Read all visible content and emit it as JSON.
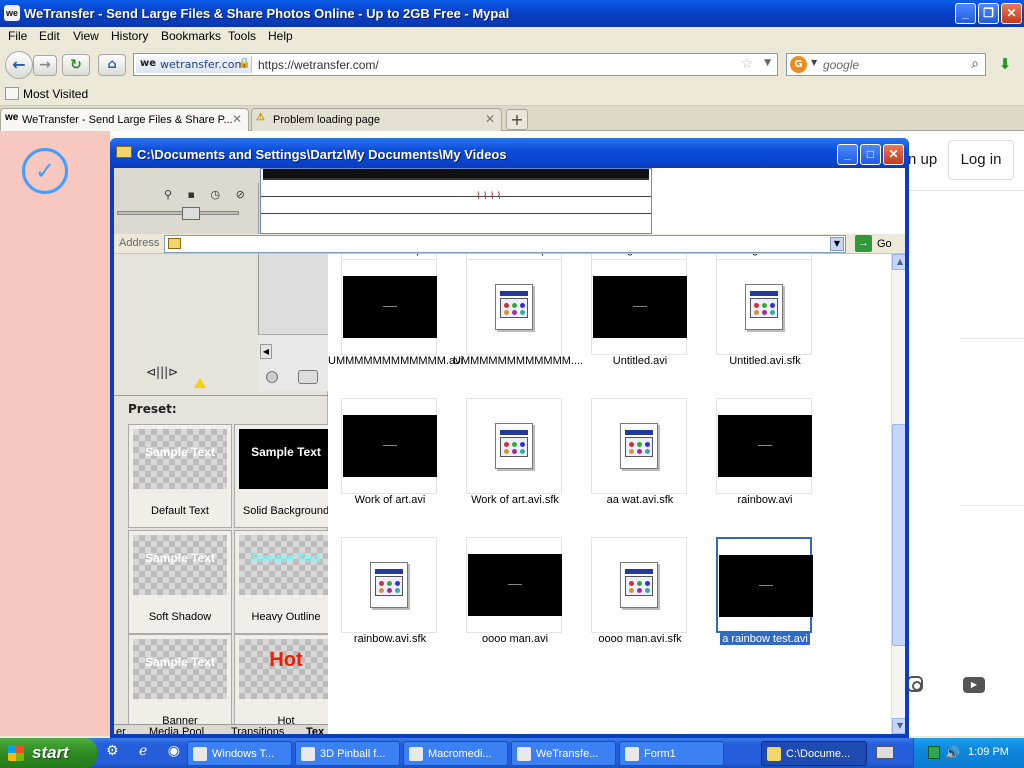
{
  "browser": {
    "title": "WeTransfer - Send Large Files & Share Photos Online - Up to 2GB Free - Mypal",
    "menu": [
      "File",
      "Edit",
      "View",
      "History",
      "Bookmarks",
      "Tools",
      "Help"
    ],
    "site_identity": "wetransfer.com",
    "url": "https://wetransfer.com/",
    "search_placeholder": "google",
    "bookmarks": [
      "Most Visited"
    ],
    "tabs": [
      {
        "label": "WeTransfer - Send Large Files & Share P...",
        "active": true
      },
      {
        "label": "Problem loading page",
        "active": false
      }
    ]
  },
  "webpage": {
    "signup_partial": "n up",
    "login_label": "Log in"
  },
  "explorer": {
    "title": "C:\\Documents and Settings\\Dartz\\My Documents\\My Videos",
    "address_label": "Address",
    "go_label": "Go",
    "files": [
      {
        "name": "so weird wat help this vid.avi",
        "kind": "video",
        "selected": false
      },
      {
        "name": "so weird wat help this vid.avi.sfk",
        "kind": "doc",
        "selected": false
      },
      {
        "name": "This is gonna be so funny!.avi",
        "kind": "video",
        "selected": false
      },
      {
        "name": "This is gonna be so funny!.avi.sfk",
        "kind": "doc",
        "selected": false
      },
      {
        "name": "UMMMMMMMMMMMM.avi",
        "kind": "video",
        "selected": false
      },
      {
        "name": "UMMMMMMMMMMMM....",
        "kind": "doc",
        "selected": false
      },
      {
        "name": "Untitled.avi",
        "kind": "video",
        "selected": false
      },
      {
        "name": "Untitled.avi.sfk",
        "kind": "doc",
        "selected": false
      },
      {
        "name": "Work of art.avi",
        "kind": "video",
        "selected": false
      },
      {
        "name": "Work of art.avi.sfk",
        "kind": "doc",
        "selected": false
      },
      {
        "name": "aa wat.avi.sfk",
        "kind": "doc",
        "selected": false
      },
      {
        "name": "rainbow.avi",
        "kind": "video",
        "selected": false
      },
      {
        "name": "rainbow.avi.sfk",
        "kind": "doc",
        "selected": false
      },
      {
        "name": "oooo man.avi",
        "kind": "video",
        "selected": false
      },
      {
        "name": "oooo man.avi.sfk",
        "kind": "doc",
        "selected": false
      },
      {
        "name": "a rainbow test.avi",
        "kind": "video",
        "selected": true
      }
    ]
  },
  "editor": {
    "preset_label": "Preset:",
    "presets": [
      {
        "sample": "Sample Text",
        "label": "Default Text",
        "style": "checker"
      },
      {
        "sample": "Sample Text",
        "label": "Solid Background",
        "style": "black"
      },
      {
        "sample": "Sample Text",
        "label": "Soft Shadow",
        "style": "checker"
      },
      {
        "sample": "Sample Text",
        "label": "Heavy Outline",
        "style": "outline"
      },
      {
        "sample": "Sample Text",
        "label": "Banner",
        "style": "checker"
      },
      {
        "sample": "Hot",
        "label": "Hot",
        "style": "hot"
      }
    ],
    "tabs": [
      "er",
      "Media Pool",
      "Transitions",
      "Tex"
    ]
  },
  "taskbar": {
    "start_label": "start",
    "tasks": [
      {
        "label": "Windows T...",
        "active": false
      },
      {
        "label": "3D Pinball f...",
        "active": false
      },
      {
        "label": "Macromedi...",
        "active": false
      },
      {
        "label": "WeTransfe...",
        "active": false
      },
      {
        "label": "Form1",
        "active": false
      },
      {
        "label": "C:\\Docume...",
        "active": true
      }
    ],
    "clock": "1:09 PM"
  }
}
